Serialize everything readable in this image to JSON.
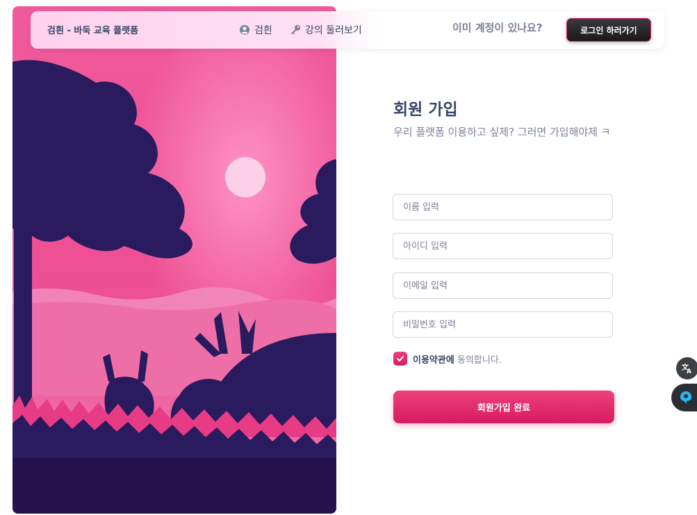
{
  "navbar": {
    "brand": "검흰 - 바둑 교육 플랫폼",
    "links": [
      {
        "label": "검흰",
        "icon": "user-circle-icon"
      },
      {
        "label": "강의 둘러보기",
        "icon": "key-icon"
      }
    ],
    "have_account": "이미 계정이 있나요?",
    "login_button": "로그인 하러가기"
  },
  "form": {
    "title": "회원 가입",
    "subtitle": "우리 플랫폼 이용하고 싶제? 그러면 가입해야제 ㅋ",
    "fields": [
      {
        "placeholder": "이름 입력",
        "value": ""
      },
      {
        "placeholder": "아이디 입력",
        "value": ""
      },
      {
        "placeholder": "이메일 입력",
        "value": ""
      },
      {
        "placeholder": "비밀번호 입력",
        "value": ""
      }
    ],
    "agree_strong": "이용약관에",
    "agree_rest": " 동의합니다.",
    "agree_checked": true,
    "submit_label": "회원가입 완료"
  },
  "floating": {
    "translate_icon": "translate-icon",
    "helper_icon": "assistant-icon"
  },
  "colors": {
    "accent": "#e91e63",
    "text_dark": "#344767",
    "text_muted": "#7b809a",
    "sky": "#ee5a9a",
    "silhouette": "#2a1a5e"
  }
}
